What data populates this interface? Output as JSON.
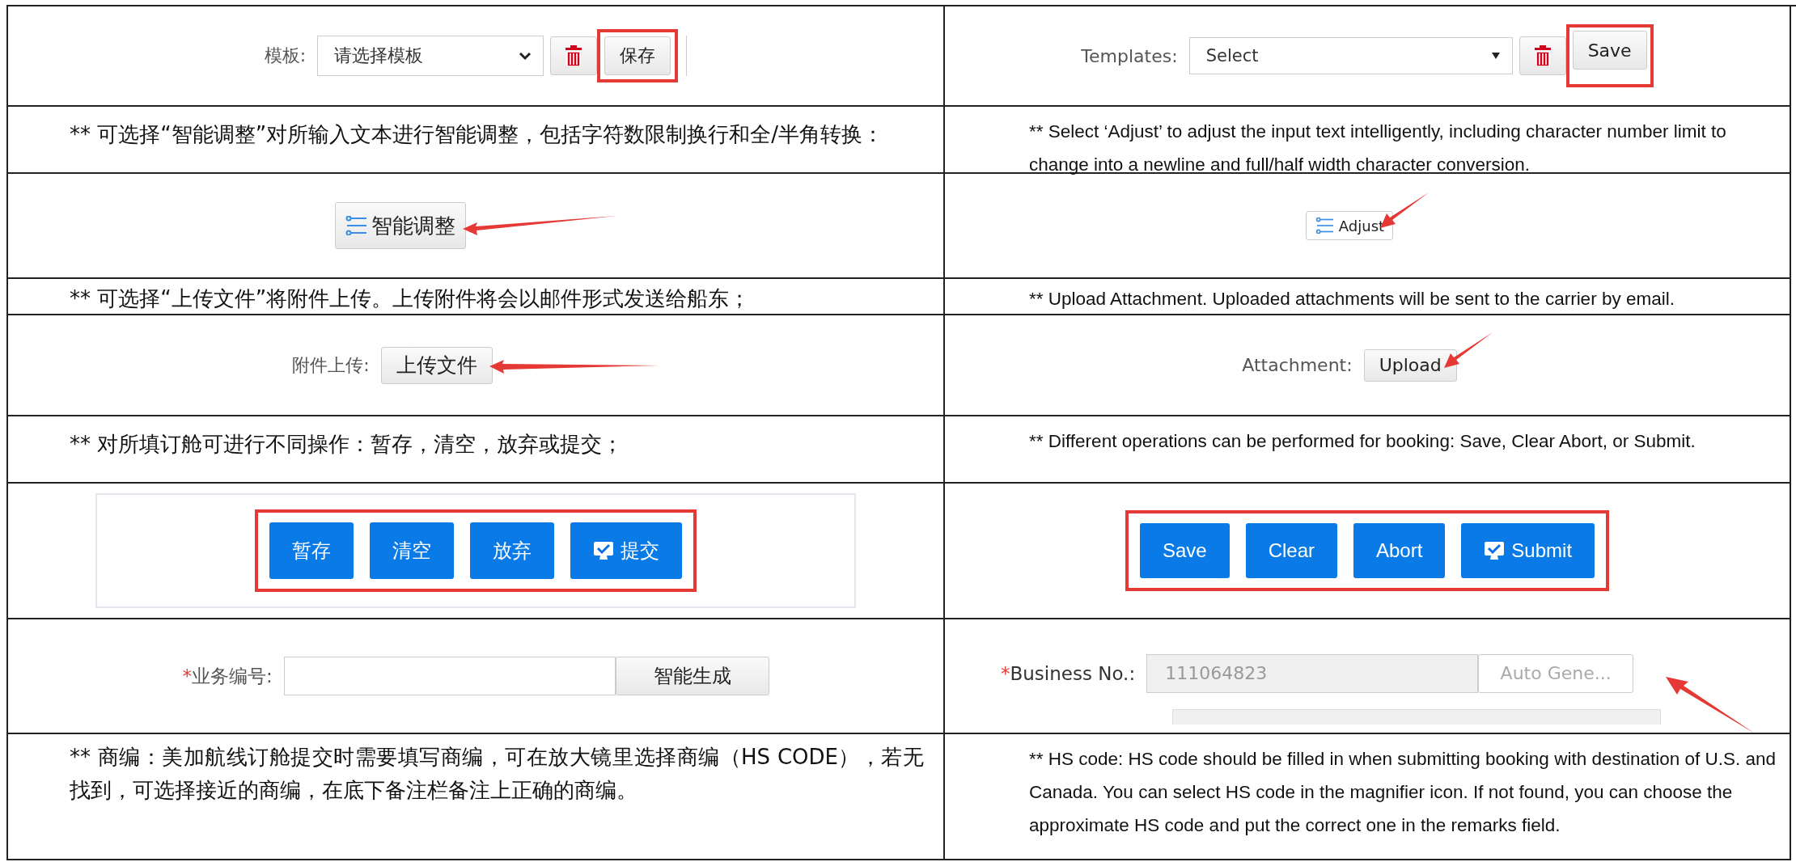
{
  "rows": [
    {
      "left": {
        "kind": "template",
        "label": "模板:",
        "select_value": "请选择模板",
        "save": "保存",
        "highlight": true
      },
      "right": {
        "kind": "template",
        "label": "Templates:",
        "select_value": "Select",
        "save": "Save",
        "highlight": true
      }
    },
    {
      "left": {
        "kind": "text",
        "text": "**  可选择“智能调整”对所输入文本进行智能调整，包括字符数限制换行和全/半角转换："
      },
      "right": {
        "kind": "text",
        "text": "** Select ‘Adjust’ to adjust the input text intelligently, including character number limit to change into a newline and full/half width character conversion."
      }
    },
    {
      "left": {
        "kind": "adjust",
        "button": "智能调整",
        "pointer": true
      },
      "right": {
        "kind": "adjust",
        "button": "Adjust",
        "pointer": true
      }
    },
    {
      "left": {
        "kind": "text",
        "text": "**  可选择“上传文件”将附件上传。上传附件将会以邮件形式发送给船东；"
      },
      "right": {
        "kind": "text",
        "text": "** Upload Attachment. Uploaded attachments will be sent to the carrier by email."
      }
    },
    {
      "left": {
        "kind": "upload",
        "label": "附件上传:",
        "button": "上传文件",
        "pointer": true
      },
      "right": {
        "kind": "upload",
        "label": "Attachment:",
        "button": "Upload",
        "pointer": true
      }
    },
    {
      "left": {
        "kind": "text",
        "text": "**  对所填订舱可进行不同操作：暂存，清空，放弃或提交；"
      },
      "right": {
        "kind": "text",
        "text": "** Different operations can be performed for booking: Save, Clear Abort, or Submit."
      }
    },
    {
      "left": {
        "kind": "actions",
        "highlight": true,
        "buttons": [
          {
            "label": "暂存",
            "icon": false
          },
          {
            "label": "清空",
            "icon": false
          },
          {
            "label": "放弃",
            "icon": false
          },
          {
            "label": "提交",
            "icon": true
          }
        ]
      },
      "right": {
        "kind": "actions",
        "highlight": true,
        "buttons": [
          {
            "label": "Save",
            "icon": false
          },
          {
            "label": "Clear",
            "icon": false
          },
          {
            "label": "Abort",
            "icon": false
          },
          {
            "label": "Submit",
            "icon": true
          }
        ]
      }
    },
    {
      "left": {
        "kind": "business",
        "mark": "*",
        "label": "业务编号:",
        "button": "智能生成",
        "pointer": false
      },
      "right": {
        "kind": "business",
        "mark": "*",
        "label": "Business No.:",
        "value": "111064823",
        "button": "Auto Gene...",
        "pointer": true
      }
    },
    {
      "left": {
        "kind": "text",
        "text": "**  商编：美加航线订舱提交时需要填写商编，可在放大镜里选择商编（HS CODE），若无找到，可选择接近的商编，在底下备注栏备注上正确的商编。"
      },
      "right": {
        "kind": "text",
        "text": "** HS code: HS code should be filled in when submitting booking with destination of U.S. and Canada. You can select HS code in the magnifier icon. If not found, you can choose the approximate HS code and put the correct one in the remarks field."
      }
    }
  ]
}
